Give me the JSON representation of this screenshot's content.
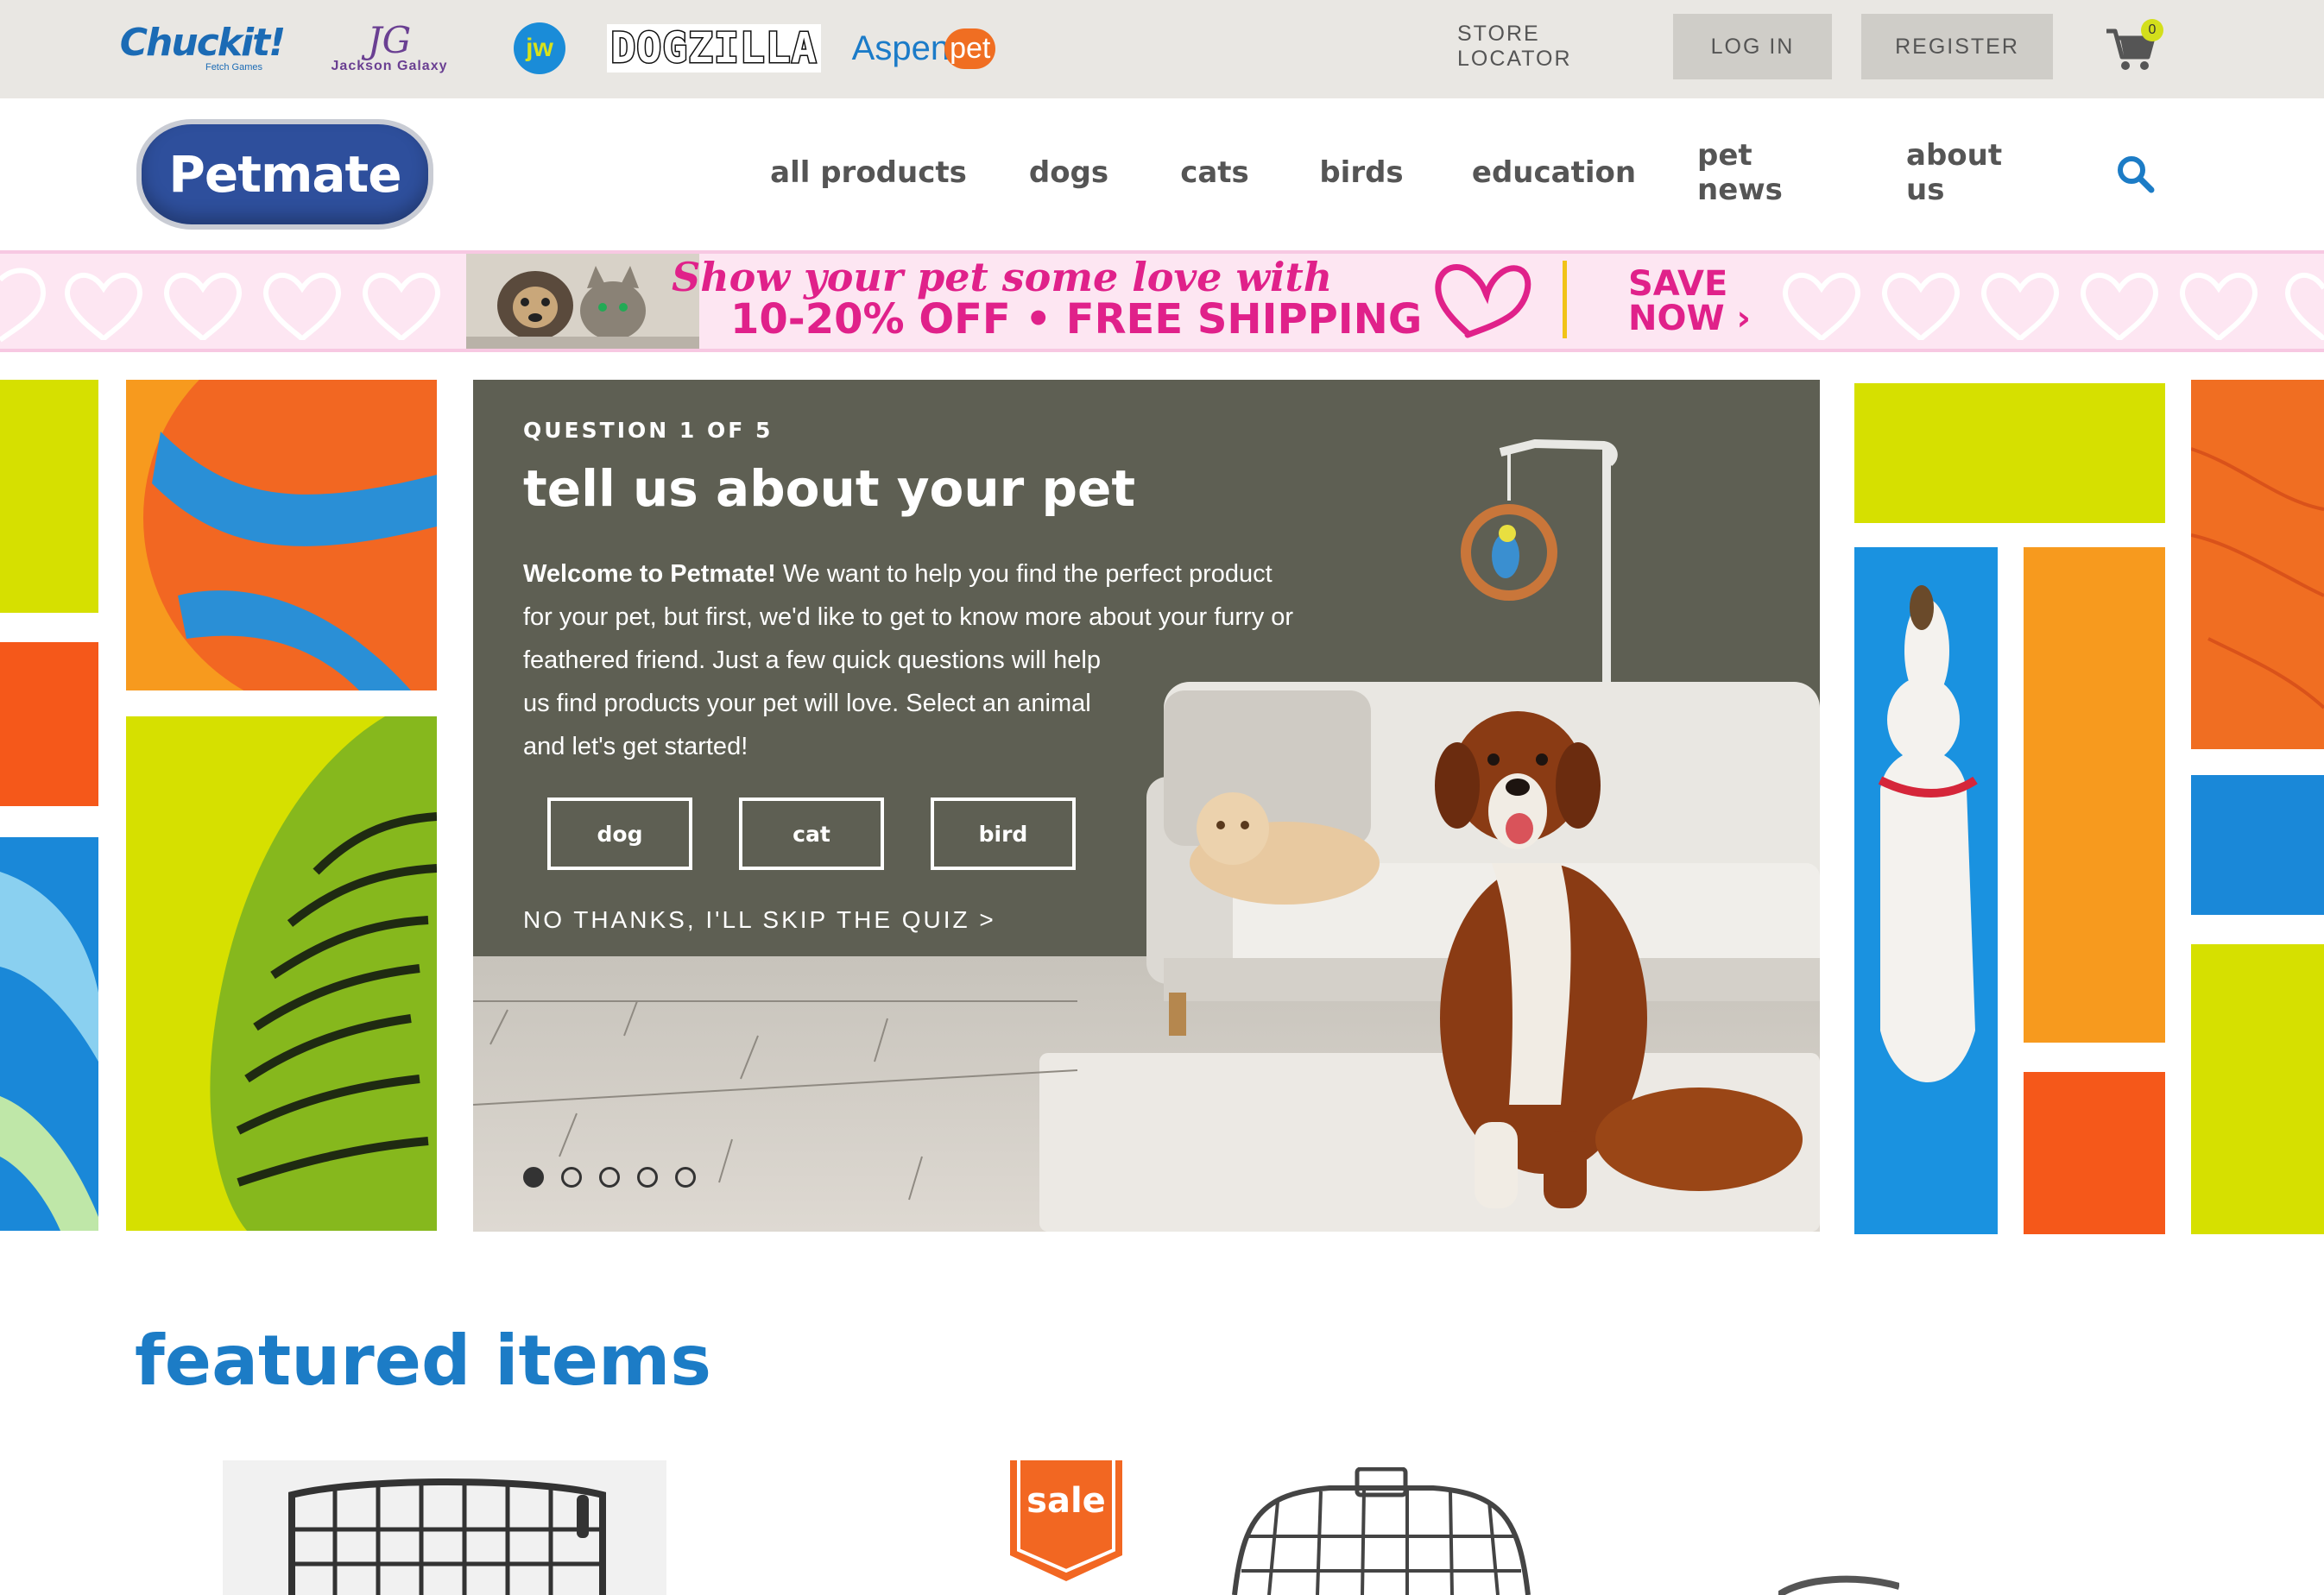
{
  "brands": [
    {
      "name": "Chuckit!",
      "tagline": "Fetch Games"
    },
    {
      "name": "Jackson Galaxy",
      "monogram": "JG"
    },
    {
      "name": "jw"
    },
    {
      "name": "DOGZILLA"
    },
    {
      "name": "Aspen",
      "suffix": "pet"
    }
  ],
  "topbar": {
    "store_locator": "STORE LOCATOR",
    "login": "LOG IN",
    "register": "REGISTER",
    "cart_count": "0"
  },
  "header": {
    "logo": "Petmate",
    "nav": [
      "all products",
      "dogs",
      "cats",
      "birds",
      "education",
      "pet news",
      "about us"
    ]
  },
  "promo": {
    "line1": "Show your pet some love with",
    "line2": "10-20% OFF • FREE SHIPPING",
    "cta_line1": "SAVE",
    "cta_line2": "NOW ›"
  },
  "quiz": {
    "step": "QUESTION 1 OF 5",
    "title": "tell us about your pet",
    "intro_bold": "Welcome to Petmate!",
    "intro_lines": [
      " We want to help you find the perfect product",
      "for your pet, but first, we'd like to get to know more about your furry or",
      "feathered friend. Just a few quick questions will help",
      "us find products your pet will love. Select an animal",
      "and let's get started!"
    ],
    "options": [
      "dog",
      "cat",
      "bird"
    ],
    "skip": "NO THANKS, I'LL SKIP THE QUIZ >",
    "slides": 5,
    "active_slide": 1
  },
  "featured": {
    "title": "featured items",
    "sale_badge": "sale"
  },
  "colors": {
    "lime": "#d6e000",
    "orange": "#f5581a",
    "amber": "#f79a1e",
    "blue": "#1a88d8",
    "pink": "#e0218a",
    "featured_blue": "#1c7cc6"
  }
}
